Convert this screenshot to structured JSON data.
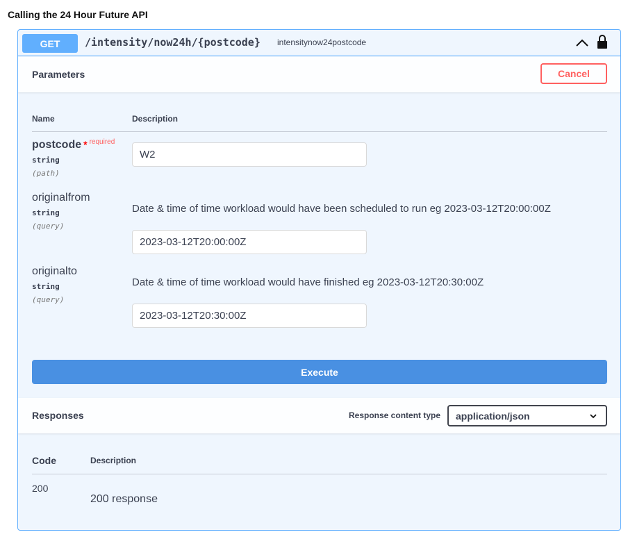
{
  "page_title": "Calling the 24 Hour Future API",
  "operation": {
    "method": "GET",
    "path": "/intensity/now24h/{postcode}",
    "operation_id": "intensitynow24postcode",
    "collapse_icon": "chevron-up-icon",
    "auth_icon": "lock-icon"
  },
  "parameters": {
    "title": "Parameters",
    "cancel_label": "Cancel",
    "col_name": "Name",
    "col_description": "Description",
    "items": [
      {
        "name": "postcode",
        "required_star": "*",
        "required_label": "required",
        "type": "string",
        "in": "(path)",
        "description": "",
        "value": "W2"
      },
      {
        "name": "originalfrom",
        "type": "string",
        "in": "(query)",
        "description": "Date & time of time workload would have been scheduled to run eg 2023-03-12T20:00:00Z",
        "value": "2023-03-12T20:00:00Z"
      },
      {
        "name": "originalto",
        "type": "string",
        "in": "(query)",
        "description": "Date & time of time workload would have finished eg 2023-03-12T20:30:00Z",
        "value": "2023-03-12T20:30:00Z"
      }
    ]
  },
  "execute_label": "Execute",
  "responses": {
    "title": "Responses",
    "content_type_label": "Response content type",
    "content_type_value": "application/json",
    "col_code": "Code",
    "col_description": "Description",
    "rows": [
      {
        "code": "200",
        "description": "200 response"
      }
    ]
  },
  "colors": {
    "get_blue": "#61affe",
    "execute_blue": "#4990e2",
    "cancel_red": "#ff6060",
    "block_bg": "#eff6fe"
  }
}
